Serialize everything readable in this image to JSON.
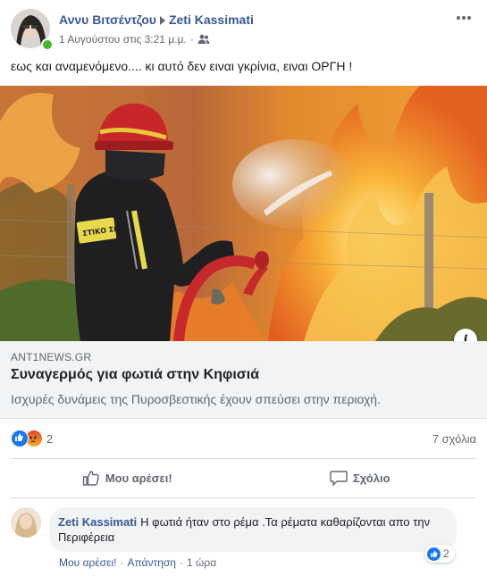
{
  "post": {
    "author": "Αννυ Βιτσέντζου",
    "target": "Zeti Kassimati",
    "timestamp": "1 Αυγούστου στις 3:21 μ.μ.",
    "separator": "·",
    "audience_icon": "friends-icon",
    "text": "εως και αναμενόμενο.... κι αυτό δεν ειναι γκρίνια, ειναι ΟΡΓΗ !"
  },
  "link": {
    "domain": "ANT1NEWS.GR",
    "title": "Συναγερμός για φωτιά στην Κηφισιά",
    "description": "Ισχυρές δυνάμεις της Πυροσβεστικής έχουν σπεύσει στην περιοχή.",
    "image_vest_text": "ΣΤΙΚΟ ΣΩΜΑ",
    "info_label": "i"
  },
  "stats": {
    "reaction_count": "2",
    "reaction_icons": [
      "like-icon",
      "angry-icon"
    ],
    "comments": "7 σχόλια"
  },
  "actions": {
    "like": "Μου αρέσει!",
    "comment": "Σχόλιο"
  },
  "comment": {
    "author": "Zeti Kassimati",
    "text": "Η φωτιά ήταν στο ρέμα .Τα ρέματα καθαρίζονται απο την Περιφέρεια",
    "like": "Μου αρέσει!",
    "reply": "Απάντηση",
    "time": "1 ώρα",
    "reaction_count": "2",
    "separator": "·"
  },
  "colors": {
    "link_blue": "#385898",
    "like_blue": "#1877f2",
    "online_green": "#42b72a"
  }
}
